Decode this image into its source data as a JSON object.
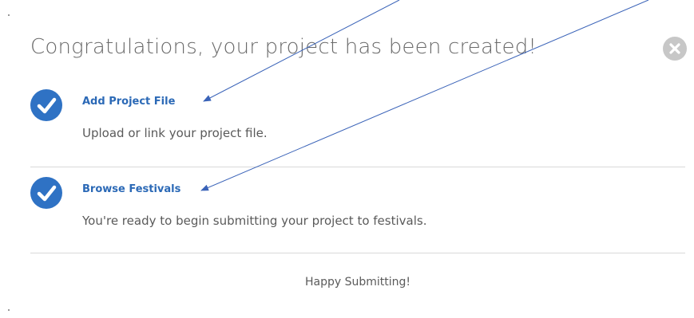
{
  "dialog": {
    "title": "Congratulations, your project has been created!",
    "close_icon": "close-circle-icon",
    "steps": [
      {
        "icon": "check-circle-icon",
        "link_label": "Add Project File",
        "description": "Upload or link your project file."
      },
      {
        "icon": "check-circle-icon",
        "link_label": "Browse Festivals",
        "description": "You're ready to begin submitting your project to festivals."
      }
    ],
    "footer": "Happy Submitting!"
  },
  "colors": {
    "accent": "#2f72c4",
    "link": "#2b69b6",
    "close_bg": "#c7c7c7",
    "arrow": "#3a63b8"
  }
}
